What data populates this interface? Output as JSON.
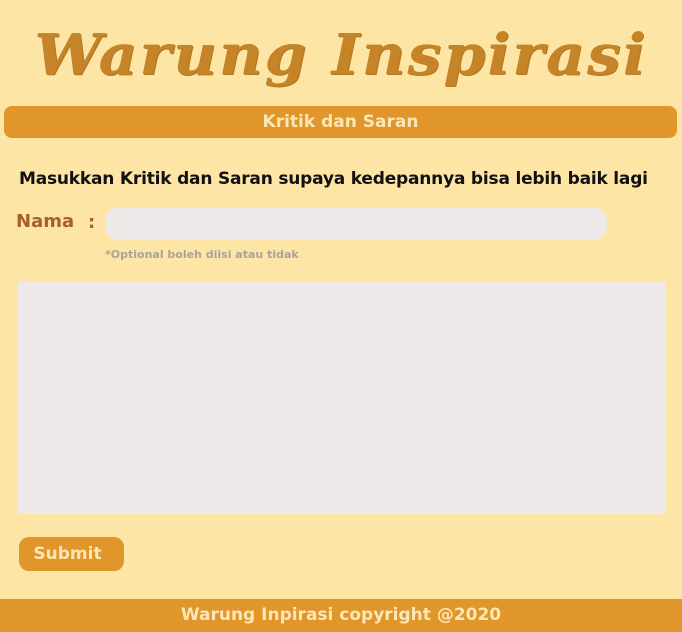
{
  "site": {
    "title": "Warung Inspirasi"
  },
  "section": {
    "title": "Kritik dan Saran"
  },
  "form": {
    "instruction": "Masukkan Kritik dan Saran supaya kedepannya bisa lebih baik lagi",
    "name_label": "Nama",
    "name_separator": ":",
    "name_value": "",
    "name_placeholder": "",
    "name_hint": "*Optional boleh diisi atau tidak",
    "message_value": "",
    "message_placeholder": "",
    "submit_label": "Submit"
  },
  "footer": {
    "text": "Warung Inpirasi copyright @2020"
  },
  "colors": {
    "background": "#fde5a6",
    "accent": "#e0962a",
    "title": "#c48427",
    "label": "#a5602b",
    "field_bg": "#eee8e9",
    "on_accent_text": "#fde7b6",
    "hint": "#a9a29a"
  }
}
